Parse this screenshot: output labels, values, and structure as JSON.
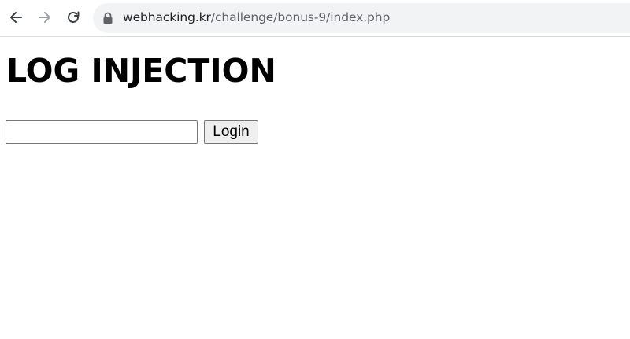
{
  "browser": {
    "url_host": "webhacking.kr",
    "url_path": "/challenge/bonus-9/index.php",
    "icons": {
      "back": "back-arrow-icon",
      "forward": "forward-arrow-icon",
      "reload": "reload-icon",
      "lock": "lock-icon"
    },
    "forward_disabled": true
  },
  "page": {
    "title": "LOG INJECTION",
    "login_input_value": "",
    "login_button_label": "Login"
  },
  "colors": {
    "omnibox_bg": "#f1f3f4",
    "button_bg": "#efefef",
    "border": "#767676"
  }
}
